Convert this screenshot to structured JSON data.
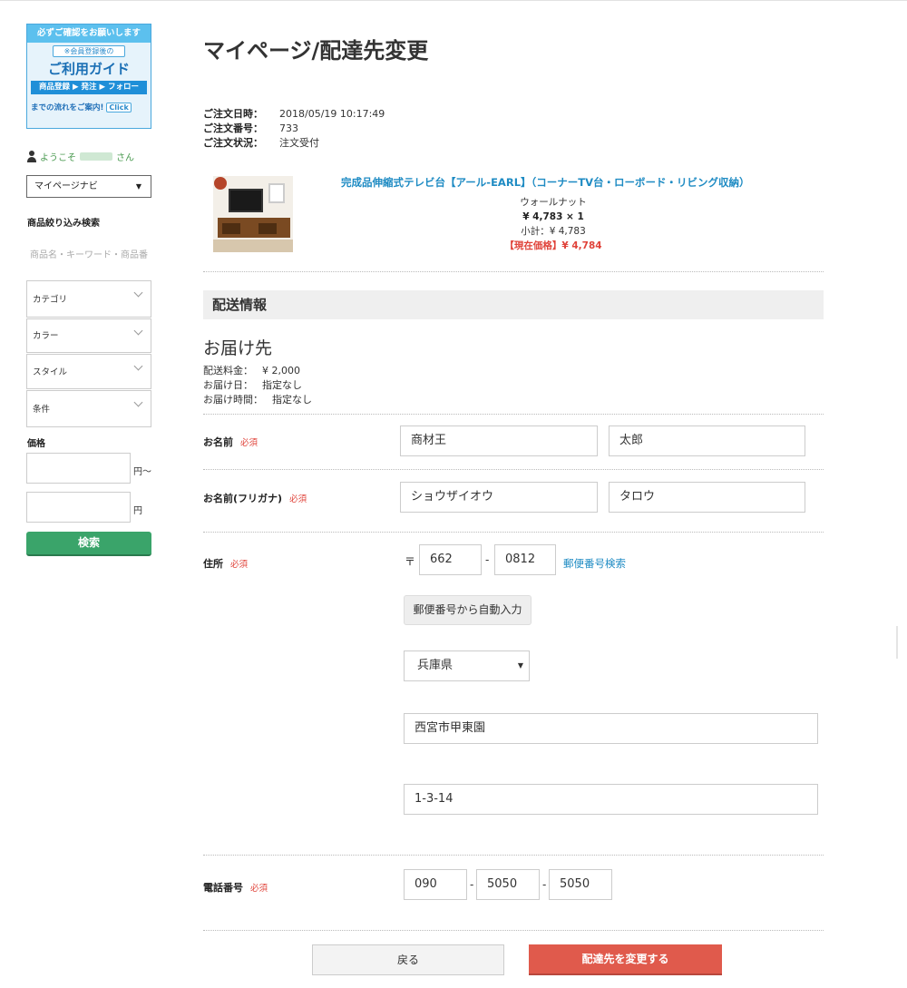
{
  "sidebar": {
    "banner": {
      "line1": "必ずご確認をお願いします",
      "line2": "※会員登録後の",
      "line3": "ご利用ガイド",
      "line4": "商品登録 ▶ 発注 ▶ フォロー",
      "line5": "までの流れをご案内!",
      "click": "Click"
    },
    "welcome_prefix": "ようこそ",
    "welcome_suffix": "さん",
    "nav_select": "マイページナビ",
    "filter_heading": "商品絞り込み検索",
    "keyword_placeholder": "商品名・キーワード・商品番",
    "filters": [
      "カテゴリ",
      "カラー",
      "スタイル",
      "条件"
    ],
    "price_heading": "価格",
    "price_unit_from": "円〜",
    "price_unit_to": "円",
    "search_button": "検索"
  },
  "page": {
    "title": "マイページ/配達先変更"
  },
  "order": {
    "date_label": "ご注文日時：",
    "date_value": "2018/05/19 10:17:49",
    "number_label": "ご注文番号：",
    "number_value": "733",
    "status_label": "ご注文状況：",
    "status_value": "注文受付"
  },
  "product": {
    "name": "完成品伸縮式テレビ台【アール-EARL】（コーナーTV台・ローボード・リビング収納）",
    "color": "ウォールナット",
    "price_qty": "¥ 4,783 × 1",
    "subtotal": "小計：¥ 4,783",
    "current_price": "【現在価格】¥ 4,784"
  },
  "shipping": {
    "section_title": "配送情報",
    "destination_title": "お届け先",
    "fee_label": "配送料金：",
    "fee_value": "¥ 2,000",
    "date_label": "お届け日：",
    "date_value": "指定なし",
    "time_label": "お届け時間：",
    "time_value": "指定なし"
  },
  "form": {
    "required": "必須",
    "name_label": "お名前",
    "last_name": "商材王",
    "first_name": "太郎",
    "kana_label": "お名前(フリガナ)",
    "last_kana": "ショウザイオウ",
    "first_kana": "タロウ",
    "address_label": "住所",
    "zip_mark": "〒",
    "zip1": "662",
    "zip2": "0812",
    "zip_dash": "-",
    "zip_search_link": "郵便番号検索",
    "auto_fill_button": "郵便番号から自動入力",
    "prefecture": "兵庫県",
    "city": "西宮市甲東園",
    "street": "1-3-14",
    "phone_label": "電話番号",
    "phone1": "090",
    "phone2": "5050",
    "phone3": "5050",
    "phone_dash": "-"
  },
  "actions": {
    "back": "戻る",
    "submit": "配達先を変更する"
  },
  "colors": {
    "accent_blue": "#1e8bc3",
    "required_red": "#e0433a",
    "search_green": "#3aa46a",
    "submit_red": "#e05a4c"
  }
}
